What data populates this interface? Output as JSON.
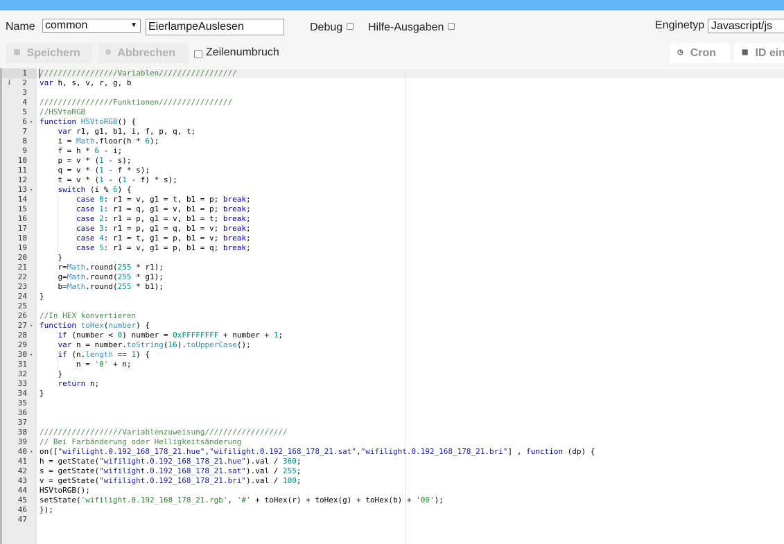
{
  "toolbar": {
    "name_label": "Name",
    "group_value": "common",
    "script_name": "EierlampeAuslesen",
    "debug_label": "Debug",
    "hilfe_label": "Hilfe-Ausgaben",
    "enginetyp_label": "Enginetyp",
    "engine_value": "Javascript/js",
    "save_label": "Speichern",
    "cancel_label": "Abbrechen",
    "wrap_label": "Zeilenumbruch",
    "cron_label": "Cron",
    "id_label": "ID ein"
  },
  "editor": {
    "lines": [
      "<span class=\"c-com\">/////////////////Variablen/////////////////</span>",
      "<span class=\"c-kw\">var</span> h, s, v, r, g, b",
      "",
      "<span class=\"c-com\">////////////////Funktionen////////////////</span>",
      "<span class=\"c-com\">//HSVtoRGB</span>",
      "<span class=\"c-kw\">function</span> <span class=\"c-fn\">HSVtoRGB</span>() {",
      "    <span class=\"c-kw\">var</span> r1, g1, b1, i, f, p, q, t;",
      "    i = <span class=\"c-fn\">Math</span>.floor(h * <span class=\"c-num\">6</span>);",
      "    f = h * <span class=\"c-num\">6</span> - i;",
      "    p = v * (<span class=\"c-num\">1</span> - s);",
      "    q = v * (<span class=\"c-num\">1</span> - f * s);",
      "    t = v * (<span class=\"c-num\">1</span> - (<span class=\"c-num\">1</span> - f) * s);",
      "    <span class=\"c-kw\">switch</span> (i % <span class=\"c-num\">6</span>) {",
      "        <span class=\"c-kw\">case</span> <span class=\"c-num\">0</span>: r1 = v, g1 = t, b1 = p; <span class=\"c-kw\">break</span>;",
      "        <span class=\"c-kw\">case</span> <span class=\"c-num\">1</span>: r1 = q, g1 = v, b1 = p; <span class=\"c-kw\">break</span>;",
      "        <span class=\"c-kw\">case</span> <span class=\"c-num\">2</span>: r1 = p, g1 = v, b1 = t; <span class=\"c-kw\">break</span>;",
      "        <span class=\"c-kw\">case</span> <span class=\"c-num\">3</span>: r1 = p, g1 = q, b1 = v; <span class=\"c-kw\">break</span>;",
      "        <span class=\"c-kw\">case</span> <span class=\"c-num\">4</span>: r1 = t, g1 = p, b1 = v; <span class=\"c-kw\">break</span>;",
      "        <span class=\"c-kw\">case</span> <span class=\"c-num\">5</span>: r1 = v, g1 = p, b1 = q; <span class=\"c-kw\">break</span>;",
      "    }",
      "    r=<span class=\"c-fn\">Math</span>.round(<span class=\"c-num\">255</span> * r1);",
      "    g=<span class=\"c-fn\">Math</span>.round(<span class=\"c-num\">255</span> * g1);",
      "    b=<span class=\"c-fn\">Math</span>.round(<span class=\"c-num\">255</span> * b1);",
      "}",
      "",
      "<span class=\"c-com\">//In HEX konvertieren</span>",
      "<span class=\"c-kw\">function</span> <span class=\"c-fn\">toHex</span>(<span class=\"c-fn\">number</span>) {",
      "    <span class=\"c-kw\">if</span> (number &lt; <span class=\"c-num\">0</span>) number = <span class=\"c-num\">0xFFFFFFFF</span> + number + <span class=\"c-num\">1</span>;",
      "    <span class=\"c-kw\">var</span> n = number.<span class=\"c-fn\">toString</span>(<span class=\"c-num\">16</span>).<span class=\"c-fn\">toUpperCase</span>();",
      "    <span class=\"c-kw\">if</span> (n.<span class=\"c-fn\">length</span> == <span class=\"c-num\">1</span>) {",
      "        n = <span class=\"c-sq\">'0'</span> + n;",
      "    }",
      "    <span class=\"c-kw\">return</span> n;",
      "}",
      "",
      "",
      "",
      "<span class=\"c-com\">//////////////////Variablenzuweisung//////////////////</span>",
      "<span class=\"c-com\">// Bei Farbänderung oder Helligkeitsänderung</span>",
      "on([<span class=\"c-str\">\"wifilight.0.192_168_178_21.hue\"</span>,<span class=\"c-str\">\"wifilight.0.192_168_178_21.sat\"</span>,<span class=\"c-str\">\"wifilight.0.192_168_178_21.bri\"</span>] , <span class=\"c-kw\">function</span> (dp) {",
      "h = getState(<span class=\"c-str\">\"wifilight.0.192_168_178_21.hue\"</span>).val / <span class=\"c-num\">360</span>;",
      "s = getState(<span class=\"c-str\">\"wifilight.0.192_168_178_21.sat\"</span>).val / <span class=\"c-num\">255</span>;",
      "v = getState(<span class=\"c-str\">\"wifilight.0.192_168_178_21.bri\"</span>).val / <span class=\"c-num\">100</span>;",
      "HSVtoRGB();",
      "setState(<span class=\"c-sq\">'wifilight.0.192_168_178_21.rgb'</span>, <span class=\"c-sq\">'#'</span> + toHex(r) + toHex(g) + toHex(b) + <span class=\"c-sq\">'00'</span>);",
      "});",
      ""
    ],
    "fold_lines": [
      6,
      13,
      27,
      30,
      40
    ],
    "info_line": 2,
    "info_marker": "i",
    "fold_marker": "▾"
  }
}
